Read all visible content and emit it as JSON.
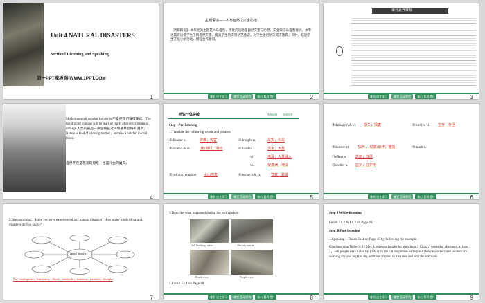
{
  "slides": [
    {
      "num": "1",
      "title": "Unit 4    NATURAL DISASTERS",
      "subtitle": "Section Ⅰ Listening and Speaking",
      "site": "第一PPT模板网-WWW.1PPT.COM"
    },
    {
      "num": "2",
      "heading": "主题语境——人与自然之灾害防范",
      "body": "【语篇概说】 本单元的主题是人与自然，涉及的话题是自然灾害与防范。安全常识与自我保护。本节语篇可以使学生了解自然灾害，提高学生的灾害防范意识，对学生进行防灾减灾教育，同时，鼓励学生开展小组活动，增强合作意识。"
    },
    {
      "num": "3",
      "heading": "单元素养目标"
    },
    {
      "num": "4",
      "en": "Misfortunes tell us what fortune is.不幸使我们懂得幸运。The last drop of humans will be tears of regret after environmental damage.人类的最后一滴泪将是对环境破坏后悔的泪水。Nature is kind of a loving mother，but also a butcher in cold blood.",
      "cn": "自然不仅是慈爱的母亲，也是冷血的屠夫。"
    },
    {
      "num": "5",
      "section": "听说一体突破",
      "tag1": "先听后练",
      "tag2": "互动交流",
      "step": "Step Ⅰ   Pre-listening",
      "task": "1.Translate the following words and phrases.",
      "items": [
        {
          "n": "①disaster n.",
          "a": "灾难；灾害"
        },
        {
          "n": "②drought n.",
          "a": "旱灾；久旱"
        },
        {
          "n": "③slide vi.& vt.",
          "a": "(使)滑行；滑动"
        },
        {
          "n": "④flood n.",
          "a": "洪水；大量"
        },
        {
          "n": "",
          "a": "vi.",
          "b": "淹没；大量涌入"
        },
        {
          "n": "",
          "a": "vt.",
          "b": "使灌满；淹没"
        },
        {
          "n": "⑤volcanic eruption",
          "a": "火山喷发"
        },
        {
          "n": "⑥rescue n.& vt.",
          "a": "营救；救援"
        }
      ]
    },
    {
      "num": "6",
      "items": [
        {
          "n": "⑦damage n.& vt.",
          "a": "损失；损害"
        },
        {
          "n": "⑧survive vi.",
          "a": "生存；存活"
        },
        {
          "n": "⑨destroy vt.",
          "a": "毁坏，(彻底)破坏；摧毁"
        },
        {
          "n": "⑩death n.",
          "a": ""
        },
        {
          "n": "⑪effect n.",
          "a": "影响；效果"
        },
        {
          "n": "⑫shelter n.",
          "a": "庇护；庇护所"
        }
      ]
    },
    {
      "num": "7",
      "q": "2.Brainstorming：Have you ever experienced any natural disasters? How many kinds of natural disasters do you know?",
      "center": "natural disasters",
      "ans": "Ⅲs：earthquake，hurricane，flood，landslide，tsunami，tornado，drought"
    },
    {
      "num": "8",
      "q": "3.Describe what happened during the earthquakes.",
      "caps": [
        "Tall buildings were",
        "The city was in",
        "Roads were",
        "People were"
      ],
      "fin": "4.Finish Ex.1 on Page 48."
    },
    {
      "num": "9",
      "step2": "Step Ⅱ    While-listening",
      "ex": "Finish Ex.2 & Ex.3 on Page 48.",
      "step3": "Step Ⅲ    Post-listening",
      "sp": "1.Speaking—Finish Ex.4 on Page 49 by following the example.",
      "body": "Good morning.Today is 13 May.A huge earthquake hit Wenchuan，China，yesterday afternoon.At least 3，500 people were killed by 13 May in the 7.8 magnitude earthquake.Rescue workers and soldiers are working day and night to dig out those trapped in the ruins and help the survivors."
    }
  ],
  "footer": {
    "b1": "课前 自主学习",
    "b2": "课堂 互动探究",
    "b3": "核心 素养提升"
  }
}
